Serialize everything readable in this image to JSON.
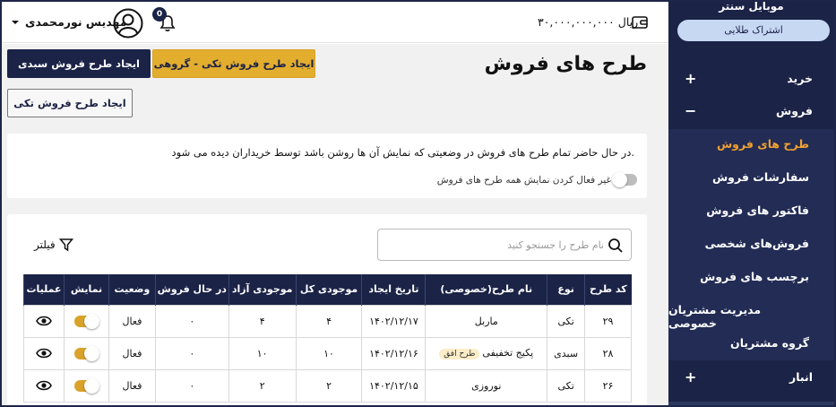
{
  "sidebar": {
    "brand": "موبایل سنتر",
    "plan": "اشتراک طلایی",
    "menu": [
      {
        "label": "خرید",
        "toggle": "+"
      },
      {
        "label": "فروش",
        "toggle": "−"
      }
    ],
    "submenu": [
      {
        "label": "طرح های فروش",
        "active": true
      },
      {
        "label": "سفارشات فروش"
      },
      {
        "label": "فاکتور های فروش"
      },
      {
        "label": "فروش‌های شخصی"
      },
      {
        "label": "برچسب های فروش"
      },
      {
        "label": "مدیریت مشتریان خصوصی"
      },
      {
        "label": "گروه مشتریان"
      }
    ],
    "bottom_menu": {
      "label": "انبار",
      "toggle": "+"
    }
  },
  "header": {
    "username": "مهدیس نورمحمدی",
    "notification_count": "0",
    "balance": "۳۰,۰۰۰,۰۰۰,۰۰۰ ریال"
  },
  "main": {
    "title": "طرح های فروش",
    "buttons": {
      "bulk": "ایجاد طرح فروش سبدی",
      "single_group": "ایجاد طرح فروش تکی - گروهی",
      "single": "ایجاد طرح فروش تکی"
    },
    "info_text": "در حال حاضر تمام طرح های فروش در وضعیتی که نمایش آن ها روشن باشد توسط خریداران دیده می شود.",
    "toggle_label": "غیر فعال کردن نمایش همه طرح های فروش",
    "search_placeholder": "نام طرح را جستجو کنید",
    "filter_label": "فیلتر"
  },
  "table": {
    "headers": [
      "کد طرح",
      "نوع",
      "نام طرح(خصوصی)",
      "تاریخ ایجاد",
      "موجودی کل",
      "موجودی آزاد",
      "در حال فروش",
      "وضعیت",
      "نمایش",
      "عملیات"
    ],
    "rows": [
      {
        "code": "۲۹",
        "type": "تکی",
        "name": "ماربل",
        "tag": "",
        "date": "۱۴۰۲/۱۲/۱۷",
        "total": "۴",
        "free": "۴",
        "selling": "۰",
        "status": "فعال"
      },
      {
        "code": "۲۸",
        "type": "سبدی",
        "name": "پکیج تخفیفی",
        "tag": "طرح افق",
        "date": "۱۴۰۲/۱۲/۱۶",
        "total": "۱۰",
        "free": "۱۰",
        "selling": "۰",
        "status": "فعال"
      },
      {
        "code": "۲۶",
        "type": "تکی",
        "name": "نوروزی",
        "tag": "",
        "date": "۱۴۰۲/۱۲/۱۵",
        "total": "۲",
        "free": "۲",
        "selling": "۰",
        "status": "فعال"
      }
    ]
  },
  "colors": {
    "navy": "#1b2347",
    "gold": "#e3ad2e",
    "active_menu": "#f0a030",
    "plan_pill": "#c7d8f3"
  },
  "icons": [
    "user-avatar-icon",
    "bell-icon",
    "chevron-down-icon",
    "wallet-icon",
    "search-icon",
    "filter-icon",
    "eye-icon"
  ]
}
